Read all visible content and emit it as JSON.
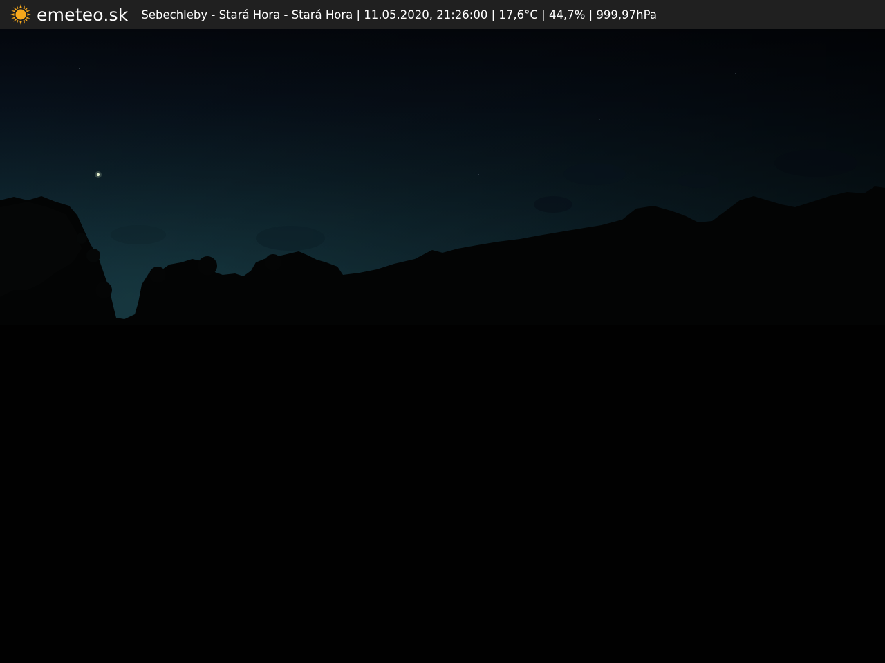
{
  "header": {
    "logo_icon": "sun-icon",
    "brand": "emeteo.sk",
    "caption": "Sebechleby - Stará Hora - Stará Hora | 11.05.2020, 21:26:00 | 17,6°C | 44,7% | 999,97hPa"
  },
  "colors": {
    "bar_background": "#202020",
    "sun": "#f7a81c",
    "text": "#ffffff"
  }
}
